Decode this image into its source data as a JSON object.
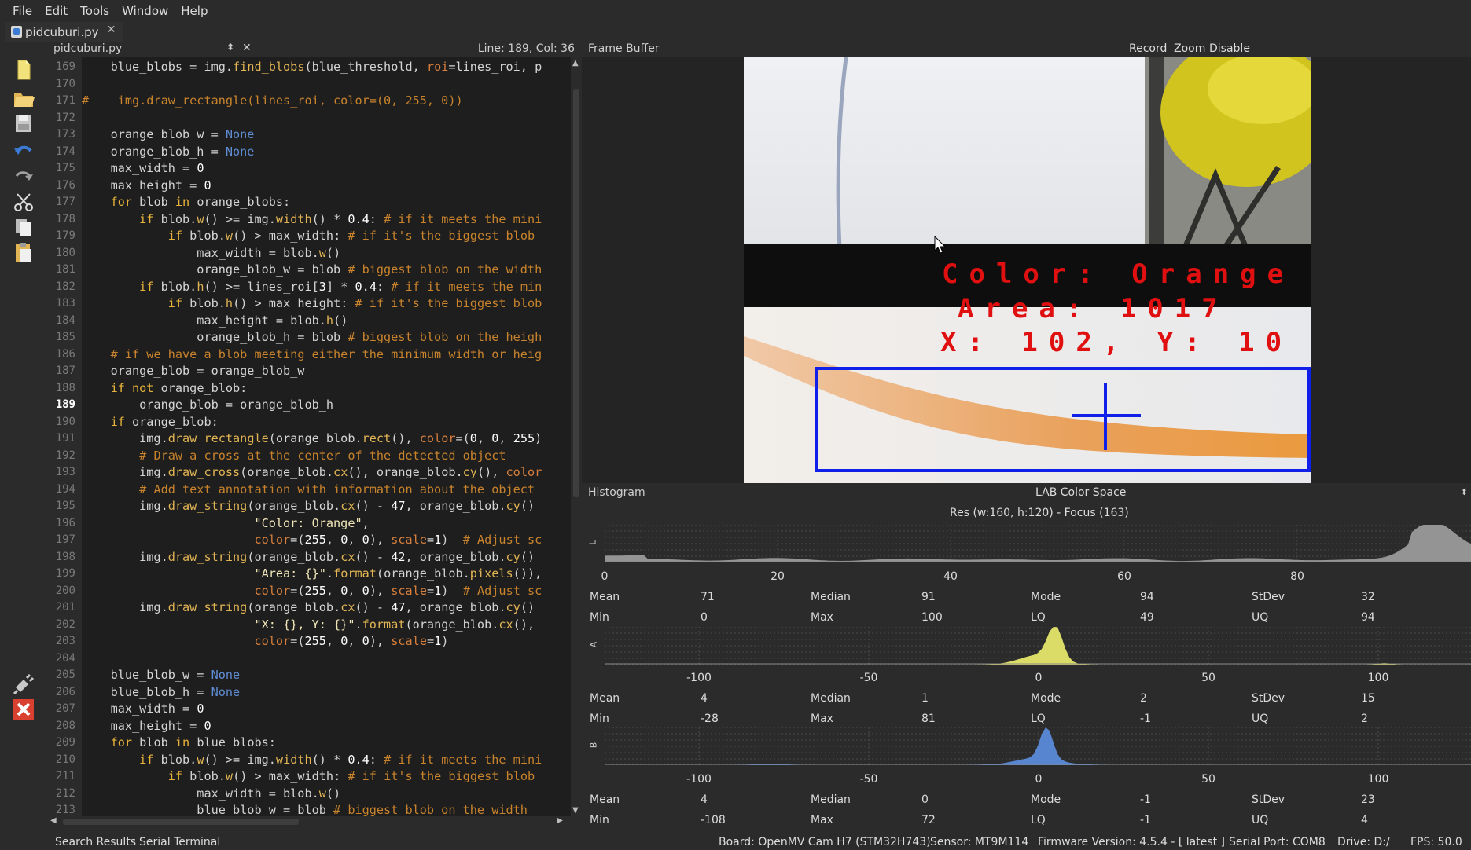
{
  "menu": [
    "File",
    "Edit",
    "Tools",
    "Window",
    "Help"
  ],
  "file_tab": {
    "label": "pidcuburi.py",
    "close": "✕"
  },
  "editor": {
    "file_name": "pidcuburi.py",
    "position": "Line: 189, Col: 36",
    "active_line": 189
  },
  "code_lines": [
    {
      "n": 169,
      "html": "    blue_blobs = img.<span class='fn'>find_blobs</span>(blue_threshold, <span class='kwarg'>roi</span>=lines_roi, p"
    },
    {
      "n": 170,
      "html": ""
    },
    {
      "n": 171,
      "html": "<span class='cm'>#    img.draw_rectangle(lines_roi, color=(0, 255, 0))</span>"
    },
    {
      "n": 172,
      "html": ""
    },
    {
      "n": 173,
      "html": "    orange_blob_w = <span class='bl'>None</span>"
    },
    {
      "n": 174,
      "html": "    orange_blob_h = <span class='bl'>None</span>"
    },
    {
      "n": 175,
      "html": "    max_width = <span class='nm'>0</span>"
    },
    {
      "n": 176,
      "html": "    max_height = <span class='nm'>0</span>"
    },
    {
      "n": 177,
      "html": "    <span class='kw'>for</span> blob <span class='kw'>in</span> orange_blobs:"
    },
    {
      "n": 178,
      "html": "        <span class='kw'>if</span> blob.<span class='fn'>w</span>() &gt;= img.<span class='fn'>width</span>() * <span class='nm'>0.4</span>: <span class='cm'># if it meets the mini</span>"
    },
    {
      "n": 179,
      "html": "            <span class='kw'>if</span> blob.<span class='fn'>w</span>() &gt; max_width: <span class='cm'># if it's the biggest blob</span>"
    },
    {
      "n": 180,
      "html": "                max_width = blob.<span class='fn'>w</span>()"
    },
    {
      "n": 181,
      "html": "                orange_blob_w = blob <span class='cm'># biggest blob on the width</span>"
    },
    {
      "n": 182,
      "html": "        <span class='kw'>if</span> blob.<span class='fn'>h</span>() &gt;= lines_roi[<span class='nm'>3</span>] * <span class='nm'>0.4</span>: <span class='cm'># if it meets the min</span>"
    },
    {
      "n": 183,
      "html": "            <span class='kw'>if</span> blob.<span class='fn'>h</span>() &gt; max_height: <span class='cm'># if it's the biggest blob</span>"
    },
    {
      "n": 184,
      "html": "                max_height = blob.<span class='fn'>h</span>()"
    },
    {
      "n": 185,
      "html": "                orange_blob_h = blob <span class='cm'># biggest blob on the heigh</span>"
    },
    {
      "n": 186,
      "html": "    <span class='cm'># if we have a blob meeting either the minimum width or heig</span>"
    },
    {
      "n": 187,
      "html": "    orange_blob = orange_blob_w"
    },
    {
      "n": 188,
      "html": "    <span class='kw'>if not</span> orange_blob:"
    },
    {
      "n": 189,
      "html": "        orange_blob = orange_blob_h"
    },
    {
      "n": 190,
      "html": "    <span class='kw'>if</span> orange_blob:"
    },
    {
      "n": 191,
      "html": "        img.<span class='fn'>draw_rectangle</span>(orange_blob.<span class='fn'>rect</span>(), <span class='kwarg'>color</span>=(<span class='nm'>0</span>, <span class='nm'>0</span>, <span class='nm'>255</span>)"
    },
    {
      "n": 192,
      "html": "        <span class='cm'># Draw a cross at the center of the detected object</span>"
    },
    {
      "n": 193,
      "html": "        img.<span class='fn'>draw_cross</span>(orange_blob.<span class='fn'>cx</span>(), orange_blob.<span class='fn'>cy</span>(), <span class='kwarg'>color</span>"
    },
    {
      "n": 194,
      "html": "        <span class='cm'># Add text annotation with information about the object</span>"
    },
    {
      "n": 195,
      "html": "        img.<span class='fn'>draw_string</span>(orange_blob.<span class='fn'>cx</span>() - <span class='nm'>47</span>, orange_blob.<span class='fn'>cy</span>()"
    },
    {
      "n": 196,
      "html": "                        <span class='str'>\"Color: Orange\"</span>,"
    },
    {
      "n": 197,
      "html": "                        <span class='kwarg'>color</span>=(<span class='nm'>255</span>, <span class='nm'>0</span>, <span class='nm'>0</span>), <span class='kwarg'>scale</span>=<span class='nm'>1</span>)  <span class='cm'># Adjust sc</span>"
    },
    {
      "n": 198,
      "html": "        img.<span class='fn'>draw_string</span>(orange_blob.<span class='fn'>cx</span>() - <span class='nm'>42</span>, orange_blob.<span class='fn'>cy</span>()"
    },
    {
      "n": 199,
      "html": "                        <span class='str'>\"Area: {}\"</span>.<span class='fn'>format</span>(orange_blob.<span class='fn'>pixels</span>()),"
    },
    {
      "n": 200,
      "html": "                        <span class='kwarg'>color</span>=(<span class='nm'>255</span>, <span class='nm'>0</span>, <span class='nm'>0</span>), <span class='kwarg'>scale</span>=<span class='nm'>1</span>)  <span class='cm'># Adjust sc</span>"
    },
    {
      "n": 201,
      "html": "        img.<span class='fn'>draw_string</span>(orange_blob.<span class='fn'>cx</span>() - <span class='nm'>47</span>, orange_blob.<span class='fn'>cy</span>()"
    },
    {
      "n": 202,
      "html": "                        <span class='str'>\"X: {}, Y: {}\"</span>.<span class='fn'>format</span>(orange_blob.<span class='fn'>cx</span>(),"
    },
    {
      "n": 203,
      "html": "                        <span class='kwarg'>color</span>=(<span class='nm'>255</span>, <span class='nm'>0</span>, <span class='nm'>0</span>), <span class='kwarg'>scale</span>=<span class='nm'>1</span>)"
    },
    {
      "n": 204,
      "html": ""
    },
    {
      "n": 205,
      "html": "    blue_blob_w = <span class='bl'>None</span>"
    },
    {
      "n": 206,
      "html": "    blue_blob_h = <span class='bl'>None</span>"
    },
    {
      "n": 207,
      "html": "    max_width = <span class='nm'>0</span>"
    },
    {
      "n": 208,
      "html": "    max_height = <span class='nm'>0</span>"
    },
    {
      "n": 209,
      "html": "    <span class='kw'>for</span> blob <span class='kw'>in</span> blue_blobs:"
    },
    {
      "n": 210,
      "html": "        <span class='kw'>if</span> blob.<span class='fn'>w</span>() &gt;= img.<span class='fn'>width</span>() * <span class='nm'>0.4</span>: <span class='cm'># if it meets the mini</span>"
    },
    {
      "n": 211,
      "html": "            <span class='kw'>if</span> blob.<span class='fn'>w</span>() &gt; max_width: <span class='cm'># if it's the biggest blob</span>"
    },
    {
      "n": 212,
      "html": "                max_width = blob.<span class='fn'>w</span>()"
    },
    {
      "n": 213,
      "html": "                blue_blob_w = blob <span class='cm'># biggest blob on the width</span>"
    }
  ],
  "frame_buffer": {
    "title": "Frame Buffer",
    "buttons": [
      "Record",
      "Zoom",
      "Disable"
    ],
    "overlay": [
      "Color: Orange",
      "Area: 1017",
      "X: 102, Y: 10"
    ]
  },
  "histogram": {
    "title": "Histogram",
    "color_space": "LAB Color Space",
    "resolution": "Res (w:160, h:120) - Focus (163)",
    "channels": [
      {
        "label": "L",
        "color": "#9a9a9a",
        "ticks": [
          "0",
          "20",
          "40",
          "60",
          "80"
        ],
        "stats": [
          [
            "Mean",
            "71"
          ],
          [
            "Median",
            "91"
          ],
          [
            "Mode",
            "94"
          ],
          [
            "StDev",
            "32"
          ],
          [
            "Min",
            "0"
          ],
          [
            "Max",
            "100"
          ],
          [
            "LQ",
            "49"
          ],
          [
            "UQ",
            "94"
          ]
        ]
      },
      {
        "label": "A",
        "color": "#e4e66a",
        "ticks": [
          "-100",
          "-50",
          "0",
          "50",
          "100"
        ],
        "stats": [
          [
            "Mean",
            "4"
          ],
          [
            "Median",
            "1"
          ],
          [
            "Mode",
            "2"
          ],
          [
            "StDev",
            "15"
          ],
          [
            "Min",
            "-28"
          ],
          [
            "Max",
            "81"
          ],
          [
            "LQ",
            "-1"
          ],
          [
            "UQ",
            "2"
          ]
        ]
      },
      {
        "label": "B",
        "color": "#5b8ad8",
        "ticks": [
          "-100",
          "-50",
          "0",
          "50",
          "100"
        ],
        "stats": [
          [
            "Mean",
            "4"
          ],
          [
            "Median",
            "0"
          ],
          [
            "Mode",
            "-1"
          ],
          [
            "StDev",
            "23"
          ],
          [
            "Min",
            "-108"
          ],
          [
            "Max",
            "72"
          ],
          [
            "LQ",
            "-1"
          ],
          [
            "UQ",
            "4"
          ]
        ]
      }
    ]
  },
  "status_bar": {
    "tabs": [
      "Search Results",
      "Serial Terminal"
    ],
    "items": [
      "Board: OpenMV Cam H7 (STM32H743)",
      "Sensor: MT9M114",
      "Firmware Version: 4.5.4 - [ latest ]",
      "Serial Port: COM8",
      "Drive: D:/",
      "FPS: 50.0"
    ]
  }
}
